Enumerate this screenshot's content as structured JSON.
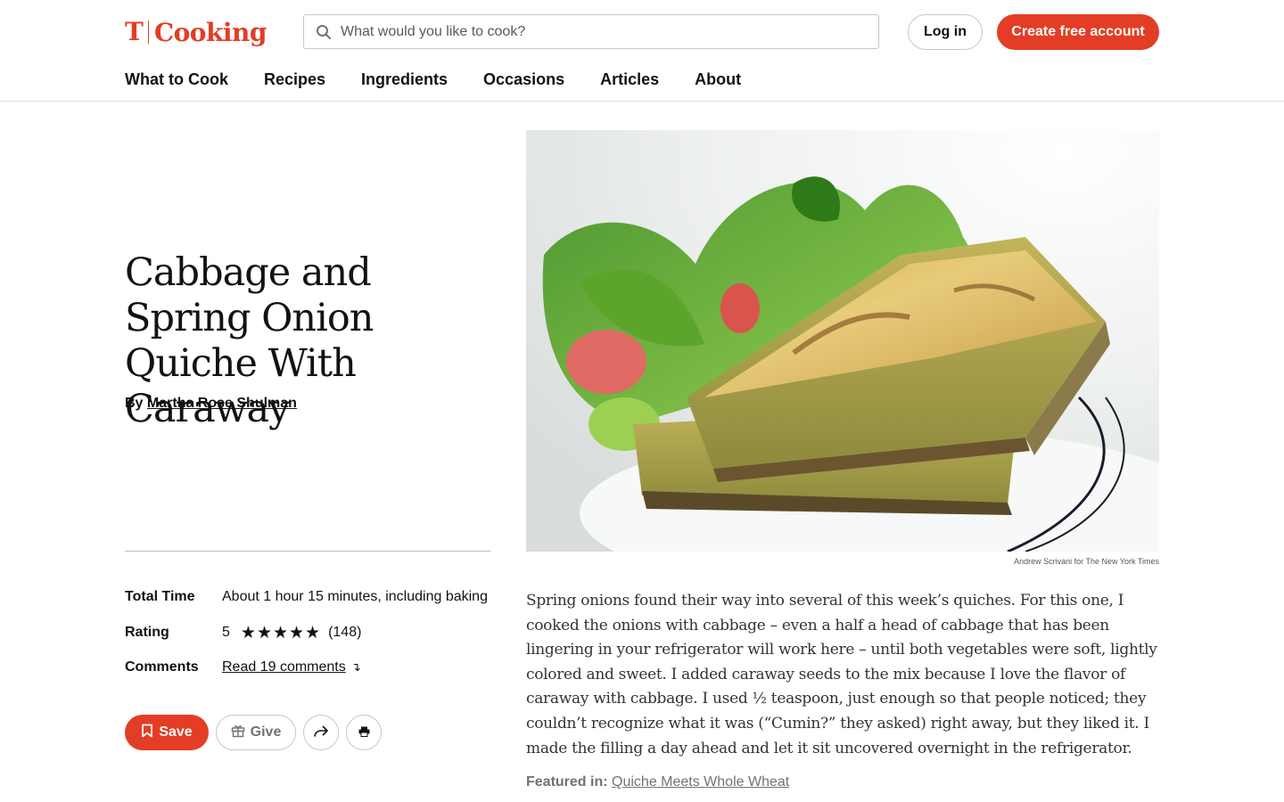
{
  "header": {
    "logo_mark": "T",
    "logo_word": "Cooking",
    "search_placeholder": "What would you like to cook?",
    "login_label": "Log in",
    "create_label": "Create free account"
  },
  "nav": [
    "What to Cook",
    "Recipes",
    "Ingredients",
    "Occasions",
    "Articles",
    "About"
  ],
  "recipe": {
    "title": "Cabbage and Spring Onion Quiche With Caraway",
    "by_prefix": "By",
    "author": "Martha Rose Shulman",
    "total_time_label": "Total Time",
    "total_time_value": "About 1 hour 15 minutes, including baking",
    "rating_label": "Rating",
    "rating_value": "5",
    "rating_stars": "★★★★★",
    "rating_count": "(148)",
    "comments_label": "Comments",
    "comments_link": "Read 19 comments",
    "photo_credit": "Andrew Scrivani for The New York Times",
    "description": "Spring onions found their way into several of this week’s quiches. For this one, I cooked the onions with cabbage – even a half a head of cabbage that has been lingering in your refrigerator will work here – until both vegetables were soft, lightly colored and sweet. I added caraway seeds to the mix because I love the flavor of caraway with cabbage. I used ½ teaspoon, just enough so that people noticed; they couldn’t recognize what it was (“Cumin?” they asked) right away, but they liked it. I made the filling a day ahead and let it sit uncovered overnight in the refrigerator.",
    "featured_label": "Featured in:",
    "featured_link": "Quiche Meets Whole Wheat"
  },
  "actions": {
    "save_label": "Save",
    "give_label": "Give"
  },
  "icons": {
    "search": "search-icon",
    "bookmark": "bookmark-icon",
    "gift": "gift-icon",
    "share": "share-icon",
    "print": "print-icon",
    "arrow_down": "arrow-down-icon"
  },
  "colors": {
    "brand": "#e33d26",
    "text": "#121212",
    "muted": "#727272"
  }
}
